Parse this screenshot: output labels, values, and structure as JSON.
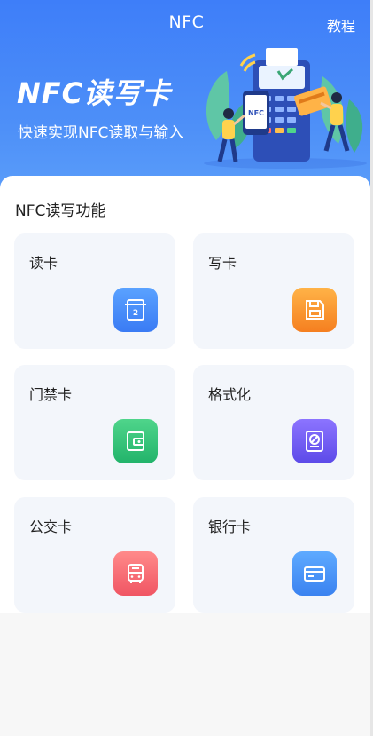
{
  "nav": {
    "title": "NFC",
    "action": "教程"
  },
  "hero": {
    "title": "NFC读写卡",
    "subtitle": "快速实现NFC读取与输入",
    "terminal_label": "NFC"
  },
  "section": {
    "title": "NFC读写功能"
  },
  "cards": [
    {
      "label": "读卡",
      "icon": "read-card-icon",
      "color_from": "#5aa2ff",
      "color_to": "#3a7bf4"
    },
    {
      "label": "写卡",
      "icon": "write-card-icon",
      "color_from": "#ffb347",
      "color_to": "#f57f20"
    },
    {
      "label": "门禁卡",
      "icon": "access-card-icon",
      "color_from": "#4fd58b",
      "color_to": "#22b36a"
    },
    {
      "label": "格式化",
      "icon": "format-icon",
      "color_from": "#8c74ff",
      "color_to": "#5c4ae8"
    },
    {
      "label": "公交卡",
      "icon": "bus-card-icon",
      "color_from": "#ff8a8a",
      "color_to": "#f05563"
    },
    {
      "label": "银行卡",
      "icon": "bank-card-icon",
      "color_from": "#5eaaff",
      "color_to": "#3a82f0"
    }
  ]
}
